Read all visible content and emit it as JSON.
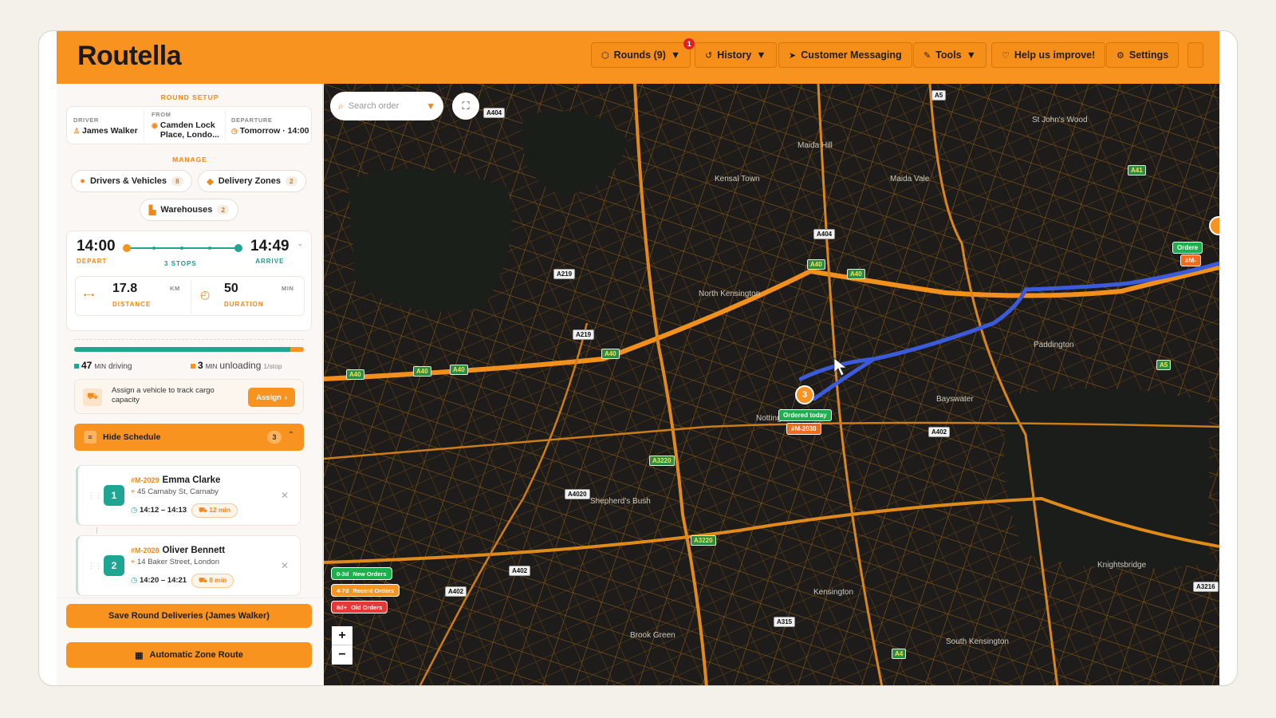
{
  "app": {
    "logo": "Routella",
    "brand_color": "#f7931e"
  },
  "nav": {
    "rounds": {
      "label": "Rounds (9)",
      "badge": "1"
    },
    "history": "History",
    "messaging": "Customer Messaging",
    "tools": "Tools",
    "help": "Help us improve!",
    "settings": "Settings"
  },
  "round_setup": {
    "title": "ROUND SETUP",
    "driver_label": "DRIVER",
    "driver": "James Walker",
    "from_label": "FROM",
    "from": "Camden Lock Place, Londo...",
    "departure_label": "DEPARTURE",
    "departure": "Tomorrow · 14:00"
  },
  "manage": {
    "title": "MANAGE",
    "drivers": {
      "label": "Drivers & Vehicles",
      "count": "8"
    },
    "zones": {
      "label": "Delivery Zones",
      "count": "2"
    },
    "warehouses": {
      "label": "Warehouses",
      "count": "2"
    }
  },
  "summary": {
    "depart_time": "14:00",
    "depart_label": "DEPART",
    "stops_label": "3 STOPS",
    "arrive_time": "14:49",
    "arrive_label": "ARRIVE",
    "distance": "17.8",
    "distance_unit": "KM",
    "distance_label": "DISTANCE",
    "duration": "50",
    "duration_unit": "MIN",
    "duration_label": "DURATION",
    "driving_fraction": 0.94,
    "driving_value": "47",
    "driving_unit": "MIN",
    "driving_text": "driving",
    "unloading_value": "3",
    "unloading_unit": "MIN",
    "unloading_text": "unloading",
    "unloading_per": "1/stop"
  },
  "vehicle_prompt": {
    "text": "Assign a vehicle to track cargo capacity",
    "button": "Assign"
  },
  "schedule": {
    "toggle_label": "Hide Schedule",
    "count": "3"
  },
  "stops": [
    {
      "num": "1",
      "order": "#M-2029",
      "name": "Emma Clarke",
      "address": "45 Carnaby St, Carnaby",
      "eta": "14:12 – 14:13",
      "mins": "12 min"
    },
    {
      "num": "2",
      "order": "#M-2028",
      "name": "Oliver Bennett",
      "address": "14 Baker Street, London",
      "eta": "14:20 – 14:21",
      "mins": "8 min"
    }
  ],
  "actions": {
    "save": "Save Round Deliveries (James Walker)",
    "auto_zone": "Automatic Zone Route"
  },
  "map": {
    "search_placeholder": "Search order",
    "labels": [
      "Maida Hill",
      "St John's Wood",
      "Kensal Town",
      "Maida Vale",
      "North Kensington",
      "Paddington",
      "Bayswater",
      "Notting",
      "Shepherd's Bush",
      "Knightsbridge",
      "Kensington",
      "Brook Green",
      "South Kensington"
    ],
    "roads": [
      "A404",
      "A5",
      "A41",
      "A404",
      "A40",
      "A40",
      "A219",
      "A219",
      "A40",
      "A40",
      "A40",
      "A40",
      "A5",
      "A402",
      "A3220",
      "A4020",
      "A3220",
      "A402",
      "A402",
      "A315",
      "A4",
      "A3216"
    ],
    "marker_num": "3",
    "marker_tag": "Ordered today",
    "marker_order": "#M-2030",
    "edge_tag": "Ordere",
    "edge_order": "#M-",
    "legend": [
      {
        "range": "0-3d",
        "label": "New Orders",
        "color": "#1fae4d"
      },
      {
        "range": "4-7d",
        "label": "Recent Orders",
        "color": "#f7931e"
      },
      {
        "range": "8d+",
        "label": "Old Orders",
        "color": "#e53935"
      }
    ],
    "zoom_in": "+",
    "zoom_out": "−"
  }
}
